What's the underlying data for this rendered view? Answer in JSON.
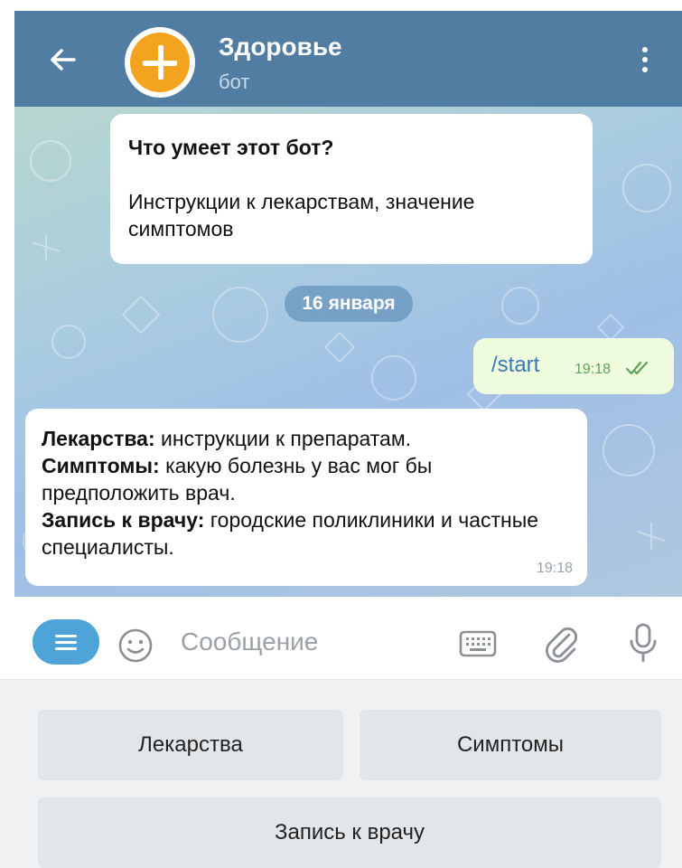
{
  "header": {
    "title": "Здоровье",
    "subtitle": "бот",
    "accent": "#517da2",
    "avatar_color": "#f4a31f"
  },
  "intro": {
    "question": "Что умеет этот бот?",
    "answer": "Инструкции к лекарствам, значение симптомов"
  },
  "date_label": "16 января",
  "outgoing": {
    "text": "/start",
    "time": "19:18",
    "status": "read"
  },
  "bot_reply": {
    "line1_bold": "Лекарства:",
    "line1_text": " инструкции к препаратам.",
    "line2_bold": "Симптомы:",
    "line2_text": " какую болезнь у вас мог бы предположить врач.",
    "line3_bold": "Запись к врачу:",
    "line3_text": " городские поликлиники и частные специалисты.",
    "time": "19:18"
  },
  "input": {
    "placeholder": "Сообщение"
  },
  "keyboard": {
    "buttons": [
      "Лекарства",
      "Симптомы",
      "Запись к врачу"
    ]
  },
  "icons": [
    "back-arrow-icon",
    "more-vertical-icon",
    "menu-icon",
    "emoji-icon",
    "keyboard-icon",
    "attach-icon",
    "mic-icon",
    "double-check-icon"
  ]
}
